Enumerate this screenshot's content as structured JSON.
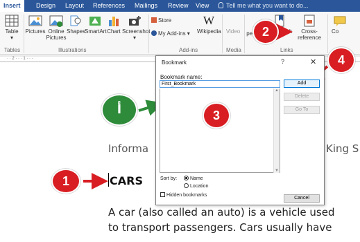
{
  "ribbon": {
    "tabs": [
      "Insert",
      "Design",
      "Layout",
      "References",
      "Mailings",
      "Review",
      "View"
    ],
    "tell_me": "Tell me what you want to do...",
    "buttons": {
      "table": "Table",
      "pictures": "Pictures",
      "online_pictures_1": "Online",
      "online_pictures_2": "Pictures",
      "shapes": "Shapes",
      "smartart": "SmartArt",
      "chart": "Chart",
      "screenshot": "Screenshot",
      "store": "Store",
      "my_addins": "My Add-ins",
      "wikipedia": "Wikipedia",
      "video": "Video",
      "hyperlink": "perlink",
      "bookmark": "Bookmark",
      "crossref_1": "Cross-",
      "crossref_2": "reference",
      "co": "Co"
    },
    "groups": {
      "tables": "Tables",
      "illustrations": "Illustrations",
      "addins": "Add-ins",
      "media": "Media",
      "links": "Links"
    }
  },
  "ruler": {
    "marks": "· · 2 · · · 1 · · ·",
    "right": "6"
  },
  "document": {
    "heading_partial_left": "Informa",
    "heading_partial_right": "King S",
    "cars_heading": "CARS",
    "para_line1": "A car (also called an auto) is a vehicle used",
    "para_line2": "to transport passengers. Cars usually have"
  },
  "dialog": {
    "title": "Bookmark",
    "help": "?",
    "close": "✕",
    "name_label": "Bookmark name:",
    "name_value": "First_Bookmark",
    "add": "Add",
    "delete": "Delete",
    "goto": "Go To",
    "sort_by": "Sort by:",
    "sort_name": "Name",
    "sort_location": "Location",
    "hidden": "Hidden bookmarks",
    "cancel": "Cancel"
  },
  "callouts": {
    "one": "1",
    "two": "2",
    "three": "3",
    "four": "4",
    "alef": "أ"
  },
  "colors": {
    "ribbon_blue": "#2b579a",
    "callout_red": "#d81e23",
    "callout_green": "#2e8b3a"
  }
}
